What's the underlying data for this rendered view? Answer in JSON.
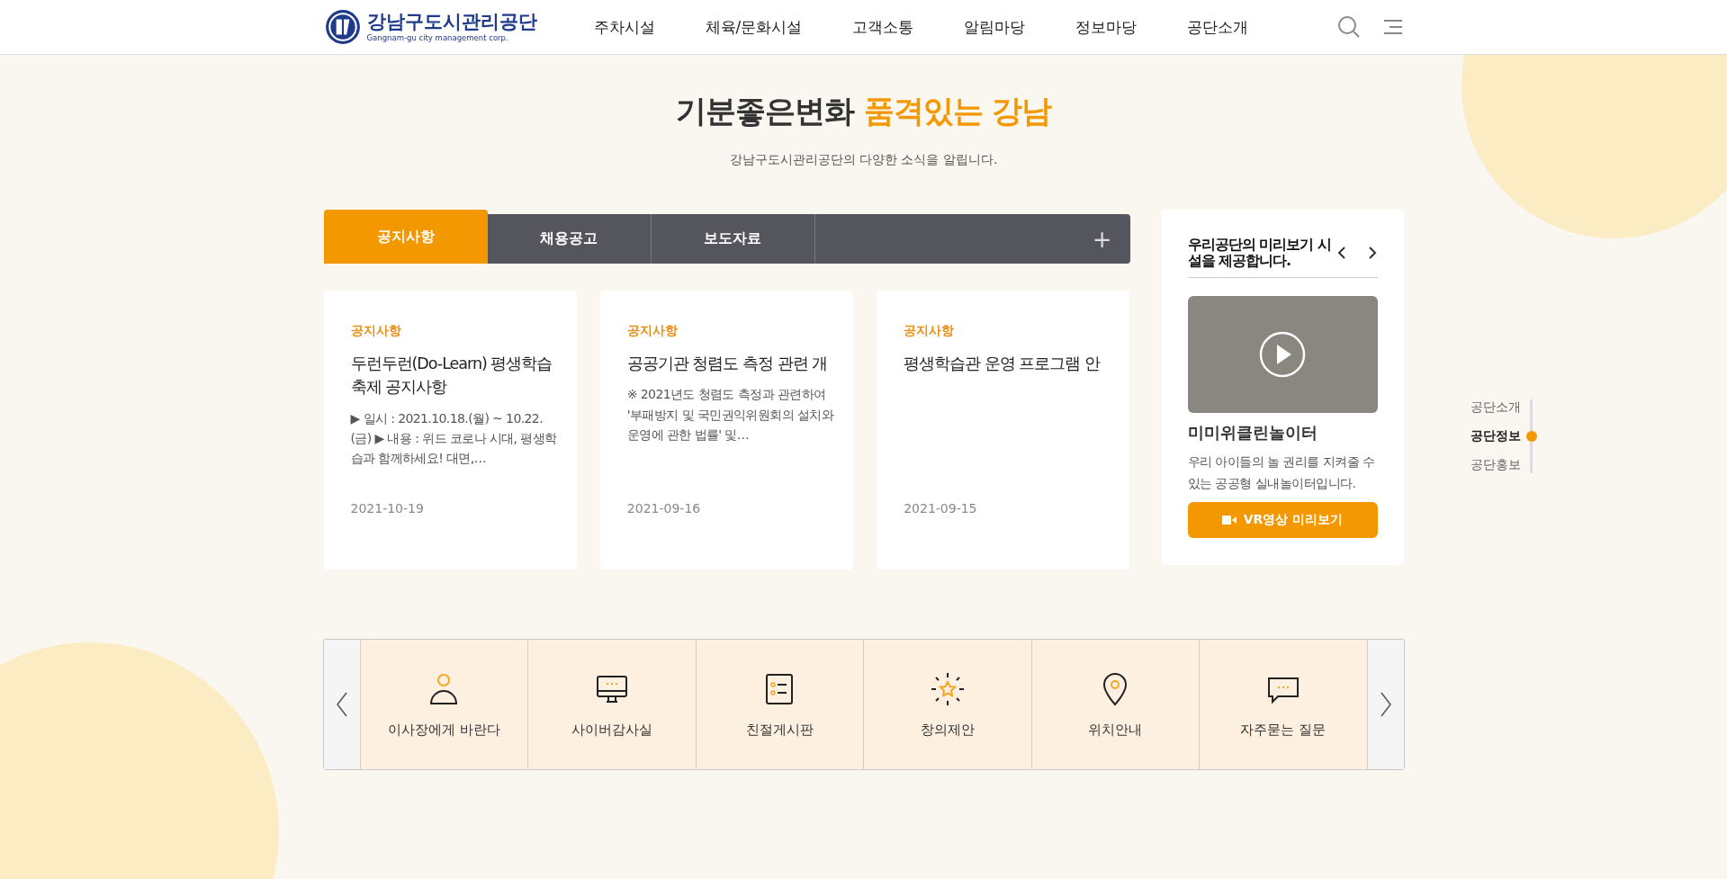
{
  "header": {
    "logo_name": "강남구도시관리공단",
    "logo_sub": "Gangnam-gu city management corp.",
    "nav": [
      "주차시설",
      "체육/문화시설",
      "고객소통",
      "알림마당",
      "정보마당",
      "공단소개"
    ]
  },
  "hero": {
    "title": "기분좋은변화",
    "title_accent": "품격있는 강남",
    "subtitle": "강남구도시관리공단의 다양한 소식을 알립니다."
  },
  "tabs": [
    {
      "label": "공지사항",
      "selected": true
    },
    {
      "label": "채용공고",
      "selected": false
    },
    {
      "label": "보도자료",
      "selected": false
    }
  ],
  "tabs_more": "+",
  "cards": [
    {
      "category": "공지사항",
      "title": "두런두런(Do-Learn) 평생학습 축제 공지사항",
      "summary": "▶ 일시 : 2021.10.18.(월) ~ 10.22.(금) ▶ 내용 : 위드 코로나 시대, 평생학습과 함께하세요! 대면,…",
      "date": "2021-10-19"
    },
    {
      "category": "공지사항",
      "title": "공공기관 청렴도 측정 관련 개",
      "summary": "※ 2021년도 청렴도 측정과 관련하여 '부패방지 및 국민권익위원회의 설치와 운영에 관한 법률' 및…",
      "date": "2021-09-16"
    },
    {
      "category": "공지사항",
      "title": "평생학습관 운영 프로그램 안",
      "date": "2021-09-15"
    }
  ],
  "preview": {
    "heading": "우리공단의 미리보기 시설을 제공합니다.",
    "place": "미미위클린놀이터",
    "description": "우리 아이들의 놀 권리를 지켜줄 수 있는 공공형 실내놀이터입니다.",
    "button": "VR영상 미리보기"
  },
  "side_nav": [
    {
      "label": "공단소개",
      "selected": false
    },
    {
      "label": "공단정보",
      "selected": true
    },
    {
      "label": "공단홍보",
      "selected": false
    }
  ],
  "quick_links": [
    {
      "label": "이사장에게 바란다",
      "kind": "person"
    },
    {
      "label": "사이버감사실",
      "kind": "monitor"
    },
    {
      "label": "친절게시판",
      "kind": "list"
    },
    {
      "label": "창의제안",
      "kind": "star"
    },
    {
      "label": "위치안내",
      "kind": "pin"
    },
    {
      "label": "자주묻는 질문",
      "kind": "chat"
    }
  ]
}
